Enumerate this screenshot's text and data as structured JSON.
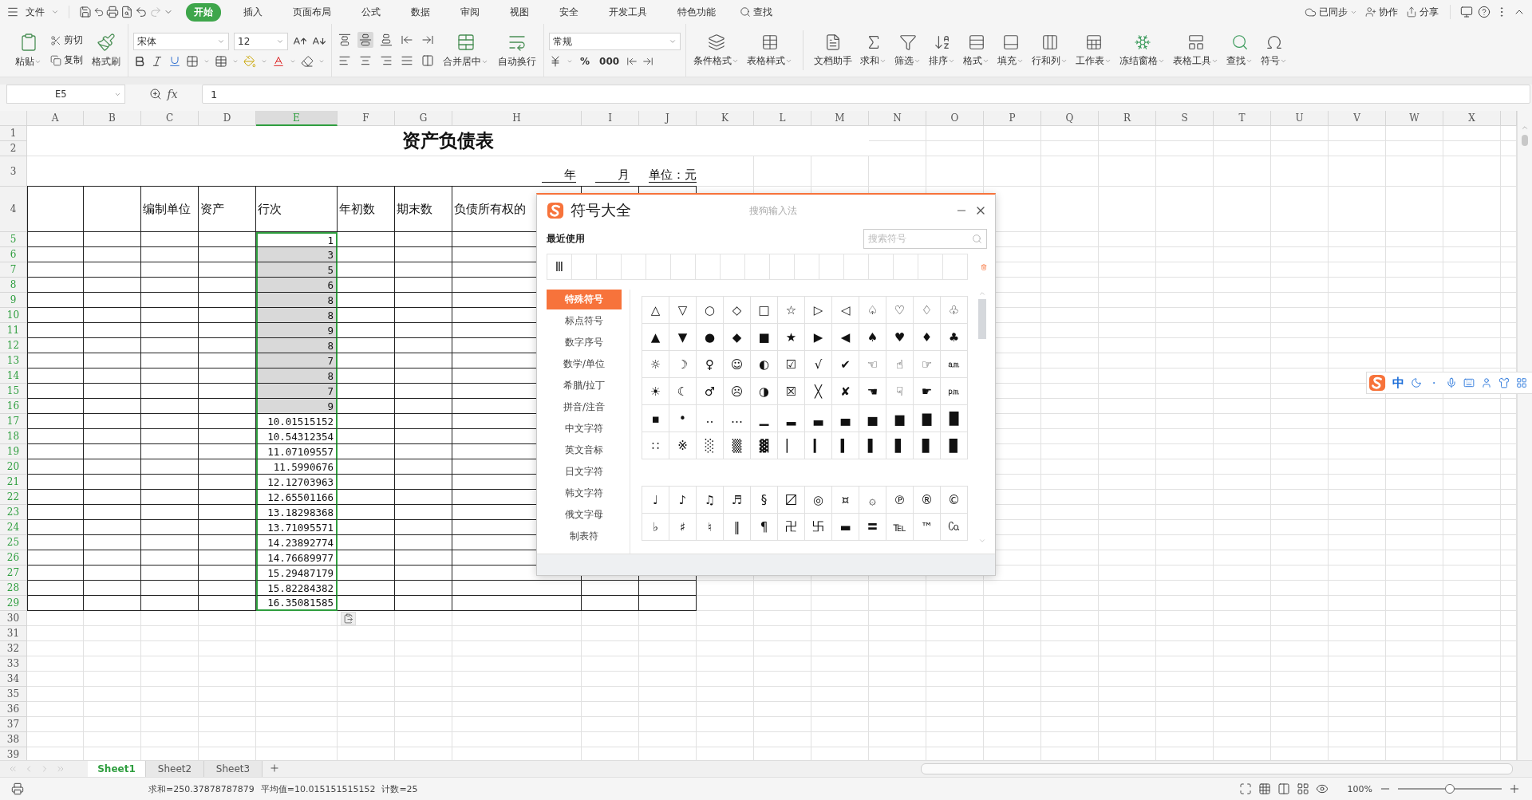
{
  "menu_bar": {
    "file_menu": "文件",
    "tabs": [
      {
        "label": "开始",
        "selected": true
      },
      {
        "label": "插入",
        "selected": false
      },
      {
        "label": "页面布局",
        "selected": false
      },
      {
        "label": "公式",
        "selected": false
      },
      {
        "label": "数据",
        "selected": false
      },
      {
        "label": "审阅",
        "selected": false
      },
      {
        "label": "视图",
        "selected": false
      },
      {
        "label": "安全",
        "selected": false
      },
      {
        "label": "开发工具",
        "selected": false
      },
      {
        "label": "特色功能",
        "selected": false
      }
    ],
    "search": "查找",
    "sync": "已同步",
    "collaborate": "协作",
    "share": "分享"
  },
  "ribbon": {
    "paste": "粘贴",
    "cut": "剪切",
    "copy": "复制",
    "format_painter": "格式刷",
    "font_name": "宋体",
    "font_size": "12",
    "merge": "合并居中",
    "wrap": "自动换行",
    "number_format": "常规",
    "number_buttons": [
      "%",
      "000"
    ],
    "tools": [
      {
        "label": "条件格式",
        "dropdown": true
      },
      {
        "label": "表格样式",
        "dropdown": true
      },
      {
        "label": "文档助手",
        "dropdown": false
      },
      {
        "label": "求和",
        "dropdown": true
      },
      {
        "label": "筛选",
        "dropdown": true
      },
      {
        "label": "排序",
        "dropdown": true
      },
      {
        "label": "格式",
        "dropdown": true
      },
      {
        "label": "填充",
        "dropdown": true
      },
      {
        "label": "行和列",
        "dropdown": true
      },
      {
        "label": "工作表",
        "dropdown": true
      },
      {
        "label": "冻结窗格",
        "dropdown": true
      },
      {
        "label": "表格工具",
        "dropdown": true
      },
      {
        "label": "查找",
        "dropdown": true
      },
      {
        "label": "符号",
        "dropdown": true
      }
    ]
  },
  "formula_bar": {
    "cell": "E5",
    "fx_label": "fx",
    "value": "1"
  },
  "sheet": {
    "columns": [
      {
        "label": "A",
        "selected": false
      },
      {
        "label": "B",
        "selected": false
      },
      {
        "label": "C",
        "selected": false
      },
      {
        "label": "D",
        "selected": false
      },
      {
        "label": "E",
        "selected": true
      },
      {
        "label": "F",
        "selected": false
      },
      {
        "label": "G",
        "selected": false
      },
      {
        "label": "H",
        "selected": false
      },
      {
        "label": "I",
        "selected": false
      },
      {
        "label": "J",
        "selected": false
      },
      {
        "label": "K",
        "selected": false
      },
      {
        "label": "L",
        "selected": false
      },
      {
        "label": "M",
        "selected": false
      },
      {
        "label": "N",
        "selected": false
      },
      {
        "label": "O",
        "selected": false
      },
      {
        "label": "P",
        "selected": false
      },
      {
        "label": "Q",
        "selected": false
      },
      {
        "label": "R",
        "selected": false
      },
      {
        "label": "S",
        "selected": false
      },
      {
        "label": "T",
        "selected": false
      },
      {
        "label": "U",
        "selected": false
      },
      {
        "label": "V",
        "selected": false
      },
      {
        "label": "W",
        "selected": false
      },
      {
        "label": "X",
        "selected": false
      }
    ],
    "rows": [
      {
        "label": "1",
        "selected": false
      },
      {
        "label": "2",
        "selected": false
      },
      {
        "label": "3",
        "selected": false
      },
      {
        "label": "4",
        "selected": false
      },
      {
        "label": "5",
        "selected": true
      },
      {
        "label": "6",
        "selected": true
      },
      {
        "label": "7",
        "selected": true
      },
      {
        "label": "8",
        "selected": true
      },
      {
        "label": "9",
        "selected": true
      },
      {
        "label": "10",
        "selected": true
      },
      {
        "label": "11",
        "selected": true
      },
      {
        "label": "12",
        "selected": true
      },
      {
        "label": "13",
        "selected": true
      },
      {
        "label": "14",
        "selected": true
      },
      {
        "label": "15",
        "selected": true
      },
      {
        "label": "16",
        "selected": true
      },
      {
        "label": "17",
        "selected": true
      },
      {
        "label": "18",
        "selected": true
      },
      {
        "label": "19",
        "selected": true
      },
      {
        "label": "20",
        "selected": true
      },
      {
        "label": "21",
        "selected": true
      },
      {
        "label": "22",
        "selected": true
      },
      {
        "label": "23",
        "selected": true
      },
      {
        "label": "24",
        "selected": true
      },
      {
        "label": "25",
        "selected": true
      },
      {
        "label": "26",
        "selected": true
      },
      {
        "label": "27",
        "selected": true
      },
      {
        "label": "28",
        "selected": true
      },
      {
        "label": "29",
        "selected": true
      },
      {
        "label": "30",
        "selected": false
      },
      {
        "label": "31",
        "selected": false
      },
      {
        "label": "32",
        "selected": false
      },
      {
        "label": "33",
        "selected": false
      },
      {
        "label": "34",
        "selected": false
      },
      {
        "label": "35",
        "selected": false
      },
      {
        "label": "36",
        "selected": false
      },
      {
        "label": "37",
        "selected": false
      },
      {
        "label": "38",
        "selected": false
      },
      {
        "label": "39",
        "selected": false
      }
    ],
    "title": "资产负债表",
    "year": "年",
    "month": "月",
    "unit": "单位：元",
    "headers": [
      "编制单位",
      "资产",
      "行次",
      "年初数",
      "期末数",
      "负债所有权的"
    ],
    "values": [
      {
        "value": "1",
        "shaded": false,
        "selected": true
      },
      {
        "value": "3",
        "shaded": true,
        "selected": true
      },
      {
        "value": "5",
        "shaded": true,
        "selected": true
      },
      {
        "value": "6",
        "shaded": true,
        "selected": true
      },
      {
        "value": "8",
        "shaded": true,
        "selected": true
      },
      {
        "value": "8",
        "shaded": true,
        "selected": true
      },
      {
        "value": "9",
        "shaded": true,
        "selected": true
      },
      {
        "value": "8",
        "shaded": true,
        "selected": true
      },
      {
        "value": "7",
        "shaded": true,
        "selected": true
      },
      {
        "value": "8",
        "shaded": true,
        "selected": true
      },
      {
        "value": "7",
        "shaded": true,
        "selected": true
      },
      {
        "value": "9",
        "shaded": true,
        "selected": true
      },
      {
        "value": "10.01515152",
        "shaded": false,
        "selected": true
      },
      {
        "value": "10.54312354",
        "shaded": false,
        "selected": true
      },
      {
        "value": "11.07109557",
        "shaded": false,
        "selected": true
      },
      {
        "value": "11.5990676",
        "shaded": false,
        "selected": true
      },
      {
        "value": "12.12703963",
        "shaded": false,
        "selected": true
      },
      {
        "value": "12.65501166",
        "shaded": false,
        "selected": true
      },
      {
        "value": "13.18298368",
        "shaded": false,
        "selected": true
      },
      {
        "value": "13.71095571",
        "shaded": false,
        "selected": true
      },
      {
        "value": "14.23892774",
        "shaded": false,
        "selected": true
      },
      {
        "value": "14.76689977",
        "shaded": false,
        "selected": true
      },
      {
        "value": "15.29487179",
        "shaded": false,
        "selected": true
      },
      {
        "value": "15.82284382",
        "shaded": false,
        "selected": true
      },
      {
        "value": "16.35081585",
        "shaded": false,
        "selected": true
      }
    ]
  },
  "sheet_tabs": [
    {
      "label": "Sheet1",
      "selected": true
    },
    {
      "label": "Sheet2",
      "selected": false
    },
    {
      "label": "Sheet3",
      "selected": false
    }
  ],
  "status_bar": {
    "stats": [
      "求和=250.37878787879",
      "平均值=10.015151515152",
      "计数=25"
    ],
    "zoom": "100%",
    "zoom_slider": {
      "level": 0.5
    }
  },
  "symbol_dialog": {
    "title": "符号大全",
    "brand": "搜狗输入法",
    "recent_label": "最近使用",
    "search_placeholder": "搜索符号",
    "recent": [
      "Ⅲ"
    ],
    "categories": [
      {
        "label": "特殊符号",
        "selected": true
      },
      {
        "label": "标点符号",
        "selected": false
      },
      {
        "label": "数字序号",
        "selected": false
      },
      {
        "label": "数学/单位",
        "selected": false
      },
      {
        "label": "希腊/拉丁",
        "selected": false
      },
      {
        "label": "拼音/注音",
        "selected": false
      },
      {
        "label": "中文字符",
        "selected": false
      },
      {
        "label": "英文音标",
        "selected": false
      },
      {
        "label": "日文字符",
        "selected": false
      },
      {
        "label": "韩文字符",
        "selected": false
      },
      {
        "label": "俄文字母",
        "selected": false
      },
      {
        "label": "制表符",
        "selected": false
      }
    ],
    "groups": [
      [
        [
          "△",
          "▽",
          "○",
          "◇",
          "□",
          "☆",
          "▷",
          "◁",
          "♤",
          "♡",
          "♢",
          "♧"
        ],
        [
          "▲",
          "▼",
          "●",
          "◆",
          "■",
          "★",
          "▶",
          "◀",
          "♠",
          "♥",
          "♦",
          "♣"
        ],
        [
          "☼",
          "☽",
          "♀",
          "☺",
          "◐",
          "☑",
          "√",
          "✔",
          "☜",
          "☝",
          "☞",
          "㏂"
        ],
        [
          "☀",
          "☾",
          "♂",
          "☹",
          "◑",
          "☒",
          "╳",
          "✘",
          "☚",
          "☟",
          "☛",
          "㏘"
        ],
        [
          "▪",
          "•",
          "‥",
          "…",
          "▁",
          "▂",
          "▃",
          "▄",
          "▅",
          "▆",
          "▇",
          "█"
        ],
        [
          "∷",
          "※",
          "░",
          "▒",
          "▓",
          "▏",
          "▎",
          "▍",
          "▌",
          "▋",
          "▊",
          "▉"
        ]
      ],
      [
        [
          "♩",
          "♪",
          "♫",
          "♬",
          "§",
          "〼",
          "◎",
          "¤",
          "۞",
          "℗",
          "®",
          "©"
        ],
        [
          "♭",
          "♯",
          "♮",
          "‖",
          "¶",
          "卍",
          "卐",
          "▬",
          "〓",
          "℡",
          "™",
          "㏇"
        ]
      ]
    ]
  },
  "ime_bar": {
    "mode": "中"
  }
}
